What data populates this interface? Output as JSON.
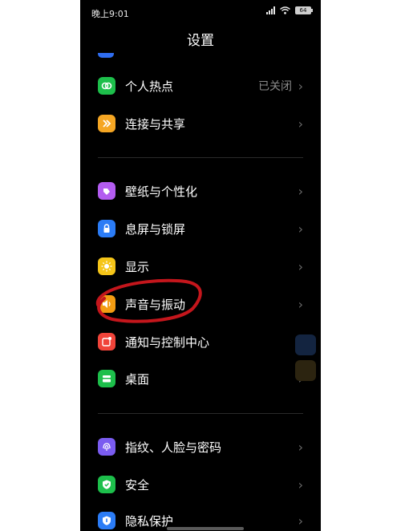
{
  "status_bar": {
    "time": "晚上9:01",
    "battery": "64"
  },
  "page": {
    "title": "设置"
  },
  "items": [
    {
      "label": "个人热点",
      "value": "已关闭",
      "icon": "hotspot-icon",
      "color": "#1dbf4b"
    },
    {
      "label": "连接与共享",
      "value": "",
      "icon": "share-arrows-icon",
      "color": "#f5a623"
    },
    {
      "label": "壁纸与个性化",
      "value": "",
      "icon": "brush-icon",
      "color": "#b35cf0"
    },
    {
      "label": "息屏与锁屏",
      "value": "",
      "icon": "lock-icon",
      "color": "#2b7cf6"
    },
    {
      "label": "显示",
      "value": "",
      "icon": "sun-icon",
      "color": "#f5c518"
    },
    {
      "label": "声音与振动",
      "value": "",
      "icon": "speaker-icon",
      "color": "#f39c12"
    },
    {
      "label": "通知与控制中心",
      "value": "",
      "icon": "notification-icon",
      "color": "#f0443a"
    },
    {
      "label": "桌面",
      "value": "",
      "icon": "desktop-icon",
      "color": "#1dbf4b"
    },
    {
      "label": "指纹、人脸与密码",
      "value": "",
      "icon": "fingerprint-icon",
      "color": "#7a5cf0"
    },
    {
      "label": "安全",
      "value": "",
      "icon": "shield-check-icon",
      "color": "#1dbf4b"
    },
    {
      "label": "隐私保护",
      "value": "",
      "icon": "privacy-shield-icon",
      "color": "#2b7cf6"
    }
  ],
  "colors": {
    "background": "#000000",
    "annotation": "#c4161c",
    "chevron": "#6a6a6a",
    "value_text": "#8a8a8a"
  }
}
